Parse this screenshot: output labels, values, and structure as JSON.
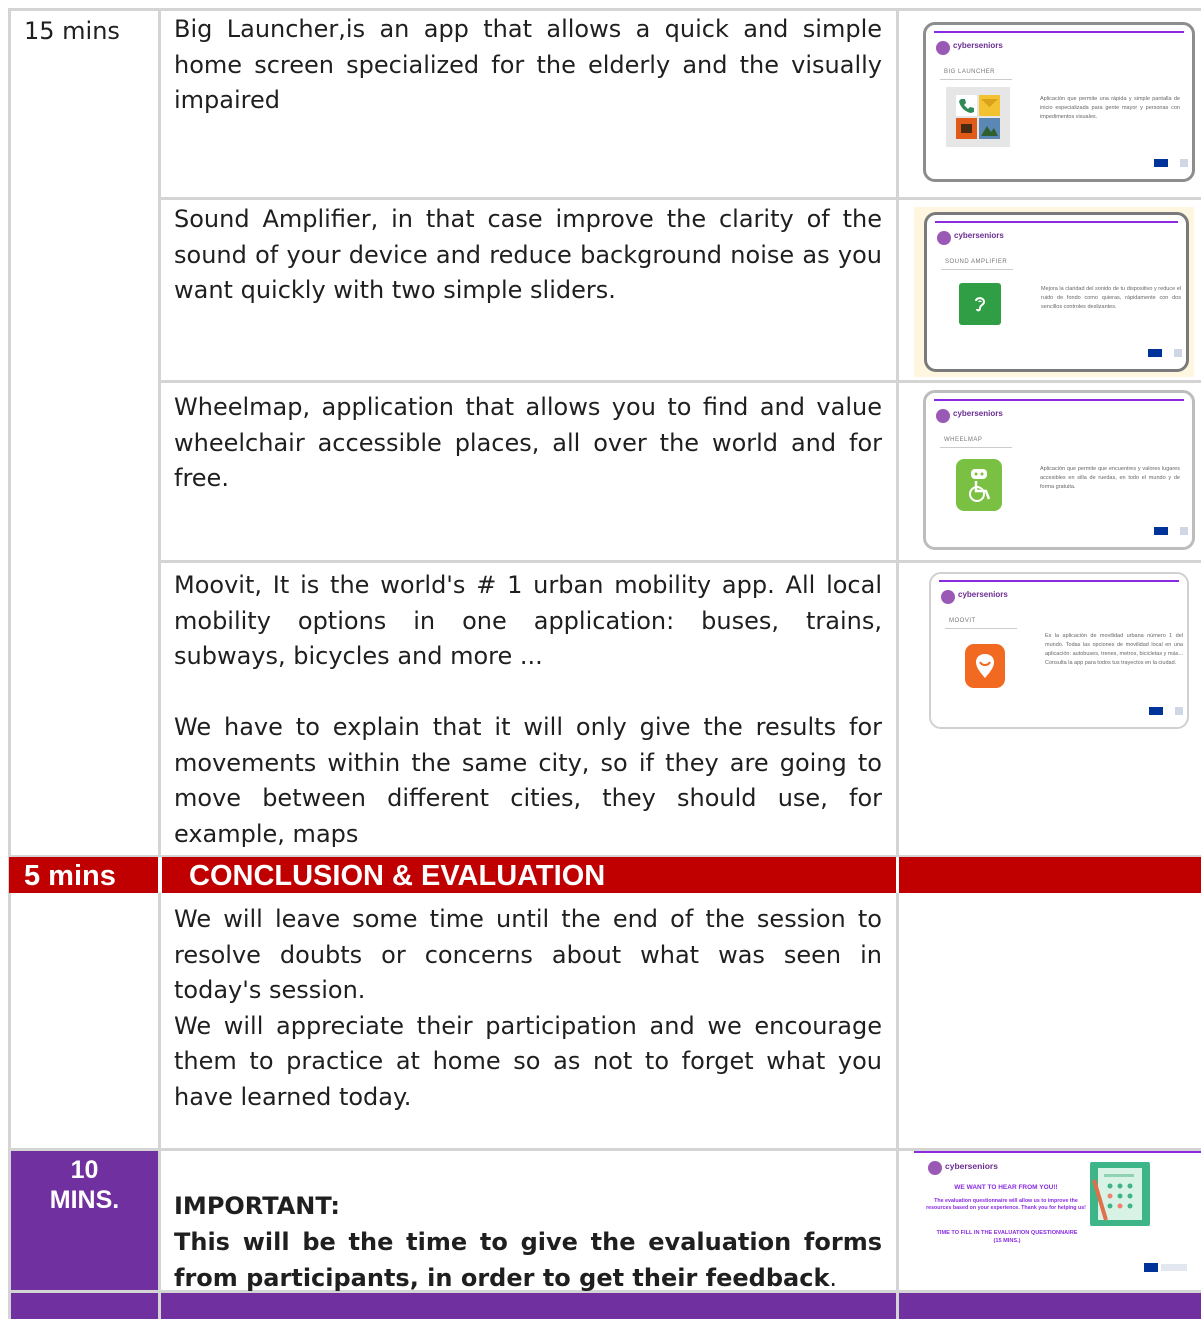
{
  "rows": {
    "time_15": "15 mins",
    "big_launcher": "Big Launcher,is an app that allows a quick and simple home screen specialized for the elderly and the visually impaired",
    "sound_amplifier": "Sound Amplifier, in that case improve the clarity of the sound of your device and reduce background noise as you want quickly with two simple sliders.",
    "wheelmap": "Wheelmap, application that allows you to find and value wheelchair accessible places, all over the world and for free.",
    "moovit_p1": "Moovit, It is the world's # 1 urban mobility app. All local mobility options in one application: buses, trains, subways, bicycles and more ...",
    "moovit_p2": "We have to explain that it will only give the results for movements within the same city, so if they are going to move between different cities, they should use, for example, maps"
  },
  "conclusion": {
    "time": "5 mins",
    "title": "CONCLUSION & EVALUATION",
    "p1": "We will leave some time until the end of the session to resolve doubts or concerns about what was seen in today's session.",
    "p2": "We will appreciate their participation and we encourage them to practice at home so as not to forget what you have learned today."
  },
  "evaluation": {
    "time_line1": "10",
    "time_line2": "MINS.",
    "important": "IMPORTANT:",
    "text_bold": "This will be the time to give the evaluation forms from participants, in order to get their feedback",
    "text_end": "."
  },
  "slides": {
    "brand": "cyberseniors",
    "s1": {
      "label": "BIG LAUNCHER",
      "desc": "Aplicación que permite una rápida y simple pantalla de inicio especializada para gente mayor y personas con impedimentos visuales."
    },
    "s2": {
      "label": "SOUND AMPLIFIER",
      "desc": "Mejora la claridad del sonido de tu dispositivo y reduce el ruido de fondo como quieras, rápidamente con dos sencillos controles deslizantes."
    },
    "s3": {
      "label": "WHEELMAP",
      "desc": "Aplicación que permite que encuentres y valores lugares accesibles en silla de ruedas, en todo el mundo y de forma gratuita."
    },
    "s4": {
      "label": "MOOVIT",
      "desc": "Es la aplicación de movilidad urbana número 1 del mundo. Todas las opciones de movilidad local en una aplicación: autobuses, trenes, metros, bicicletas y más... Consulta la app para todos tus trayectos en la ciudad."
    },
    "eval": {
      "heading": "WE WANT TO HEAR FROM YOU!!",
      "body": "The evaluation questionnaire will allow us to improve the resources based on your experience. Thank you for helping us!",
      "cta": "TIME TO FILL IN THE EVALUATION QUESTIONNAIRE (15 MINS.)"
    }
  },
  "colors": {
    "red_band": "#c00000",
    "purple_band": "#7030a0",
    "grid": "#d4d4d4"
  }
}
